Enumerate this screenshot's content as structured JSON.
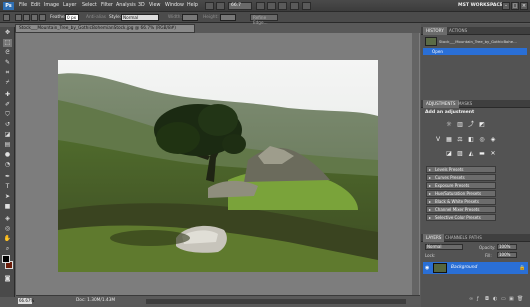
{
  "app": {
    "logo": "Ps",
    "menu": [
      "File",
      "Edit",
      "Image",
      "Layer",
      "Select",
      "Filter",
      "Analysis",
      "3D",
      "View",
      "Window",
      "Help"
    ],
    "zoom_select": "66.7",
    "workspace": "MST WORKSPACE ▾",
    "window_buttons": [
      "–",
      "□",
      "×"
    ]
  },
  "options_bar": {
    "feather_label": "Feather:",
    "feather_value": "0 px",
    "antialias_label": "Anti-alias",
    "style_label": "Style:",
    "style_value": "Normal",
    "width_label": "Width:",
    "height_label": "Height:",
    "refine_edge": "Refine Edge..."
  },
  "document": {
    "tab_title": "Stock___Mountain_Tree_by_GothicBohemianStock.jpg @ 66.7% (RGB/8#)",
    "status_zoom": "66.67%",
    "status_doc": "Doc: 1.30M/1.43M"
  },
  "history_panel": {
    "tabs": [
      "HISTORY",
      "ACTIONS"
    ],
    "snapshot_label": "Stock___Mountain_Tree_by_GothicBohe...",
    "state_label": "Open"
  },
  "adjustments_panel": {
    "tabs": [
      "ADJUSTMENTS",
      "MASKS"
    ],
    "title": "Add an adjustment",
    "presets": [
      "Levels Presets",
      "Curves Presets",
      "Exposure Presets",
      "Hue/Saturation Presets",
      "Black & White Presets",
      "Channel Mixer Presets",
      "Selective Color Presets"
    ]
  },
  "layers_panel": {
    "tabs": [
      "LAYERS",
      "CHANNELS",
      "PATHS"
    ],
    "blend_mode": "Normal",
    "opacity_label": "Opacity:",
    "opacity_value": "100%",
    "lock_label": "Lock:",
    "fill_label": "Fill:",
    "fill_value": "100%",
    "layer_name": "Background"
  },
  "colors": {
    "selection_blue": "#2a6fd6",
    "foreground": "#000000",
    "background": "#6b1d0a"
  }
}
